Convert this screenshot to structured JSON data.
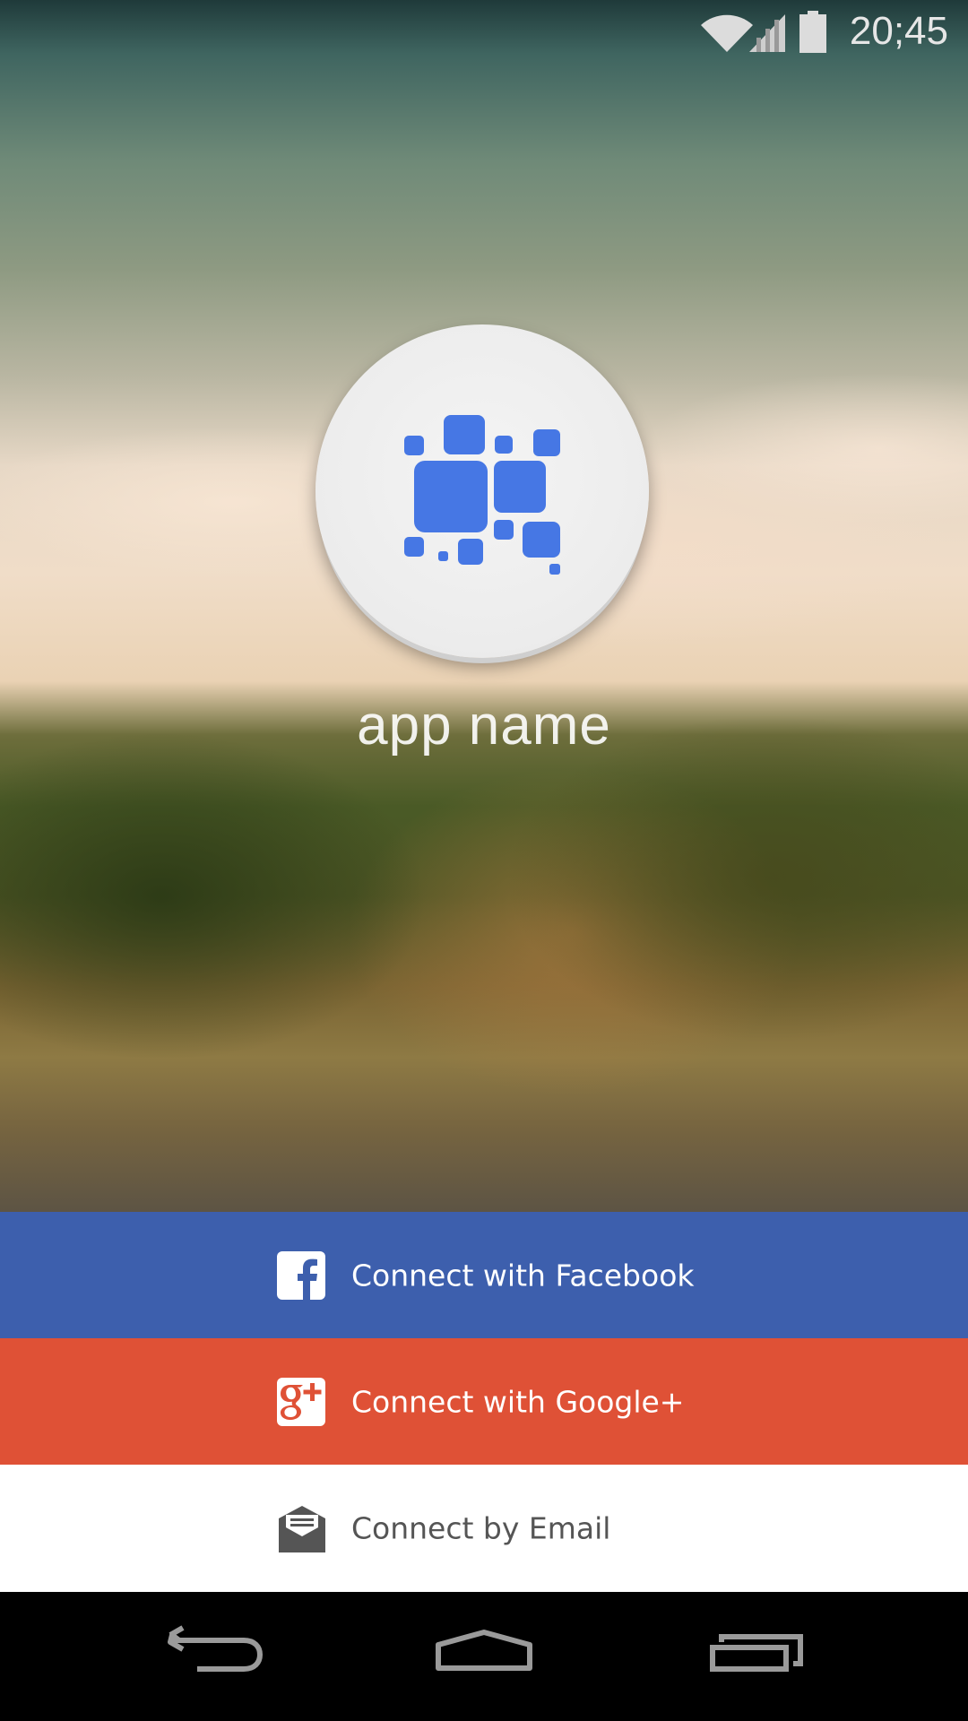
{
  "status_bar": {
    "time": "20;45",
    "icons": [
      "wifi-icon",
      "cell-signal-icon",
      "battery-icon"
    ]
  },
  "app": {
    "logo_icon": "blue-squares-logo-icon",
    "name": "app name"
  },
  "auth_buttons": [
    {
      "label": "Connect with Facebook",
      "icon": "facebook-icon",
      "color": "#3d5fad"
    },
    {
      "label": "Connect with Google+",
      "icon": "google-plus-icon",
      "color": "#df5136"
    },
    {
      "label": "Connect by Email",
      "icon": "envelope-icon",
      "color": "#ffffff"
    }
  ],
  "nav_bar": {
    "icons": [
      "back-icon",
      "home-icon",
      "recent-apps-icon"
    ]
  },
  "colors": {
    "logo_blue": "#4677e4",
    "facebook_blue": "#3d5fad",
    "google_red": "#df5136"
  }
}
